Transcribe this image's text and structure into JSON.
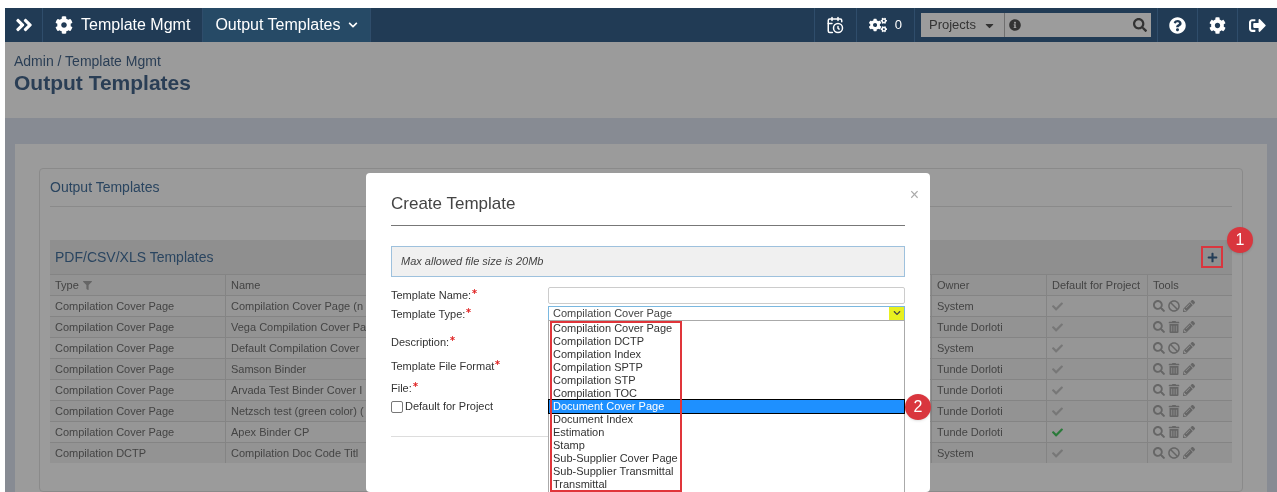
{
  "nav": {
    "crumbs": [
      {
        "label": "Template Mgmt",
        "kind": "module"
      },
      {
        "label": "Output Templates",
        "kind": "menu"
      }
    ],
    "jobs_count": "0",
    "project_select": "Projects"
  },
  "breadcrumb": "Admin / Template Mgmt",
  "page_title": "Output Templates",
  "card_title": "Output Templates",
  "table": {
    "title": "PDF/CSV/XLS Templates",
    "columns": [
      "Type",
      "Name",
      "Owner",
      "Default for Project",
      "Tools"
    ],
    "rows": [
      {
        "type": "Compilation Cover Page",
        "name": "Compilation Cover Page (n",
        "owner": "System",
        "default_checked": false,
        "deletable": false
      },
      {
        "type": "Compilation Cover Page",
        "name": "Vega Compilation Cover Pa",
        "owner": "Tunde Dorloti",
        "default_checked": false,
        "deletable": true
      },
      {
        "type": "Compilation Cover Page",
        "name": "Default Compilation Cover",
        "owner": "System",
        "default_checked": false,
        "deletable": false
      },
      {
        "type": "Compilation Cover Page",
        "name": "Samson Binder",
        "owner": "Tunde Dorloti",
        "default_checked": false,
        "deletable": true
      },
      {
        "type": "Compilation Cover Page",
        "name": "Arvada Test Binder Cover I",
        "owner": "Tunde Dorloti",
        "default_checked": false,
        "deletable": true
      },
      {
        "type": "Compilation Cover Page",
        "name": "Netzsch test (green color) (",
        "owner": "Tunde Dorloti",
        "default_checked": false,
        "deletable": true
      },
      {
        "type": "Compilation Cover Page",
        "name": "Apex Binder CP",
        "owner": "Tunde Dorloti",
        "default_checked": true,
        "deletable": true
      },
      {
        "type": "Compilation DCTP",
        "name": "Compilation Doc Code Titl",
        "owner": "System",
        "default_checked": false,
        "deletable": false
      }
    ]
  },
  "modal": {
    "title": "Create Template",
    "close": "×",
    "notice": "Max allowed file size is 20Mb",
    "fields": [
      {
        "label": "Template Name:",
        "required": true,
        "kind": "text"
      },
      {
        "label": "Template Type:",
        "required": true,
        "kind": "select",
        "value": "Compilation Cover Page"
      },
      {
        "label": "Description:",
        "required": true,
        "kind": "label"
      },
      {
        "label": "Template File Format",
        "required": true,
        "kind": "label"
      },
      {
        "label": "File: ",
        "required": true,
        "kind": "label"
      },
      {
        "label": "Default for Project",
        "kind": "checkbox",
        "checked": false
      }
    ],
    "options": [
      {
        "label": "Compilation Cover Page",
        "selected": false
      },
      {
        "label": "Compilation DCTP",
        "selected": false
      },
      {
        "label": "Compilation Index",
        "selected": false
      },
      {
        "label": "Compilation SPTP",
        "selected": false
      },
      {
        "label": "Compilation STP",
        "selected": false
      },
      {
        "label": "Compilation TOC",
        "selected": false
      },
      {
        "label": "Document Cover Page",
        "selected": true
      },
      {
        "label": "Document Index",
        "selected": false
      },
      {
        "label": "Estimation",
        "selected": false
      },
      {
        "label": "Stamp",
        "selected": false
      },
      {
        "label": "Sub-Supplier Cover Page",
        "selected": false
      },
      {
        "label": "Sub-Supplier Transmittal",
        "selected": false
      },
      {
        "label": "Transmittal",
        "selected": false
      }
    ]
  },
  "callouts": [
    "1",
    "2"
  ]
}
